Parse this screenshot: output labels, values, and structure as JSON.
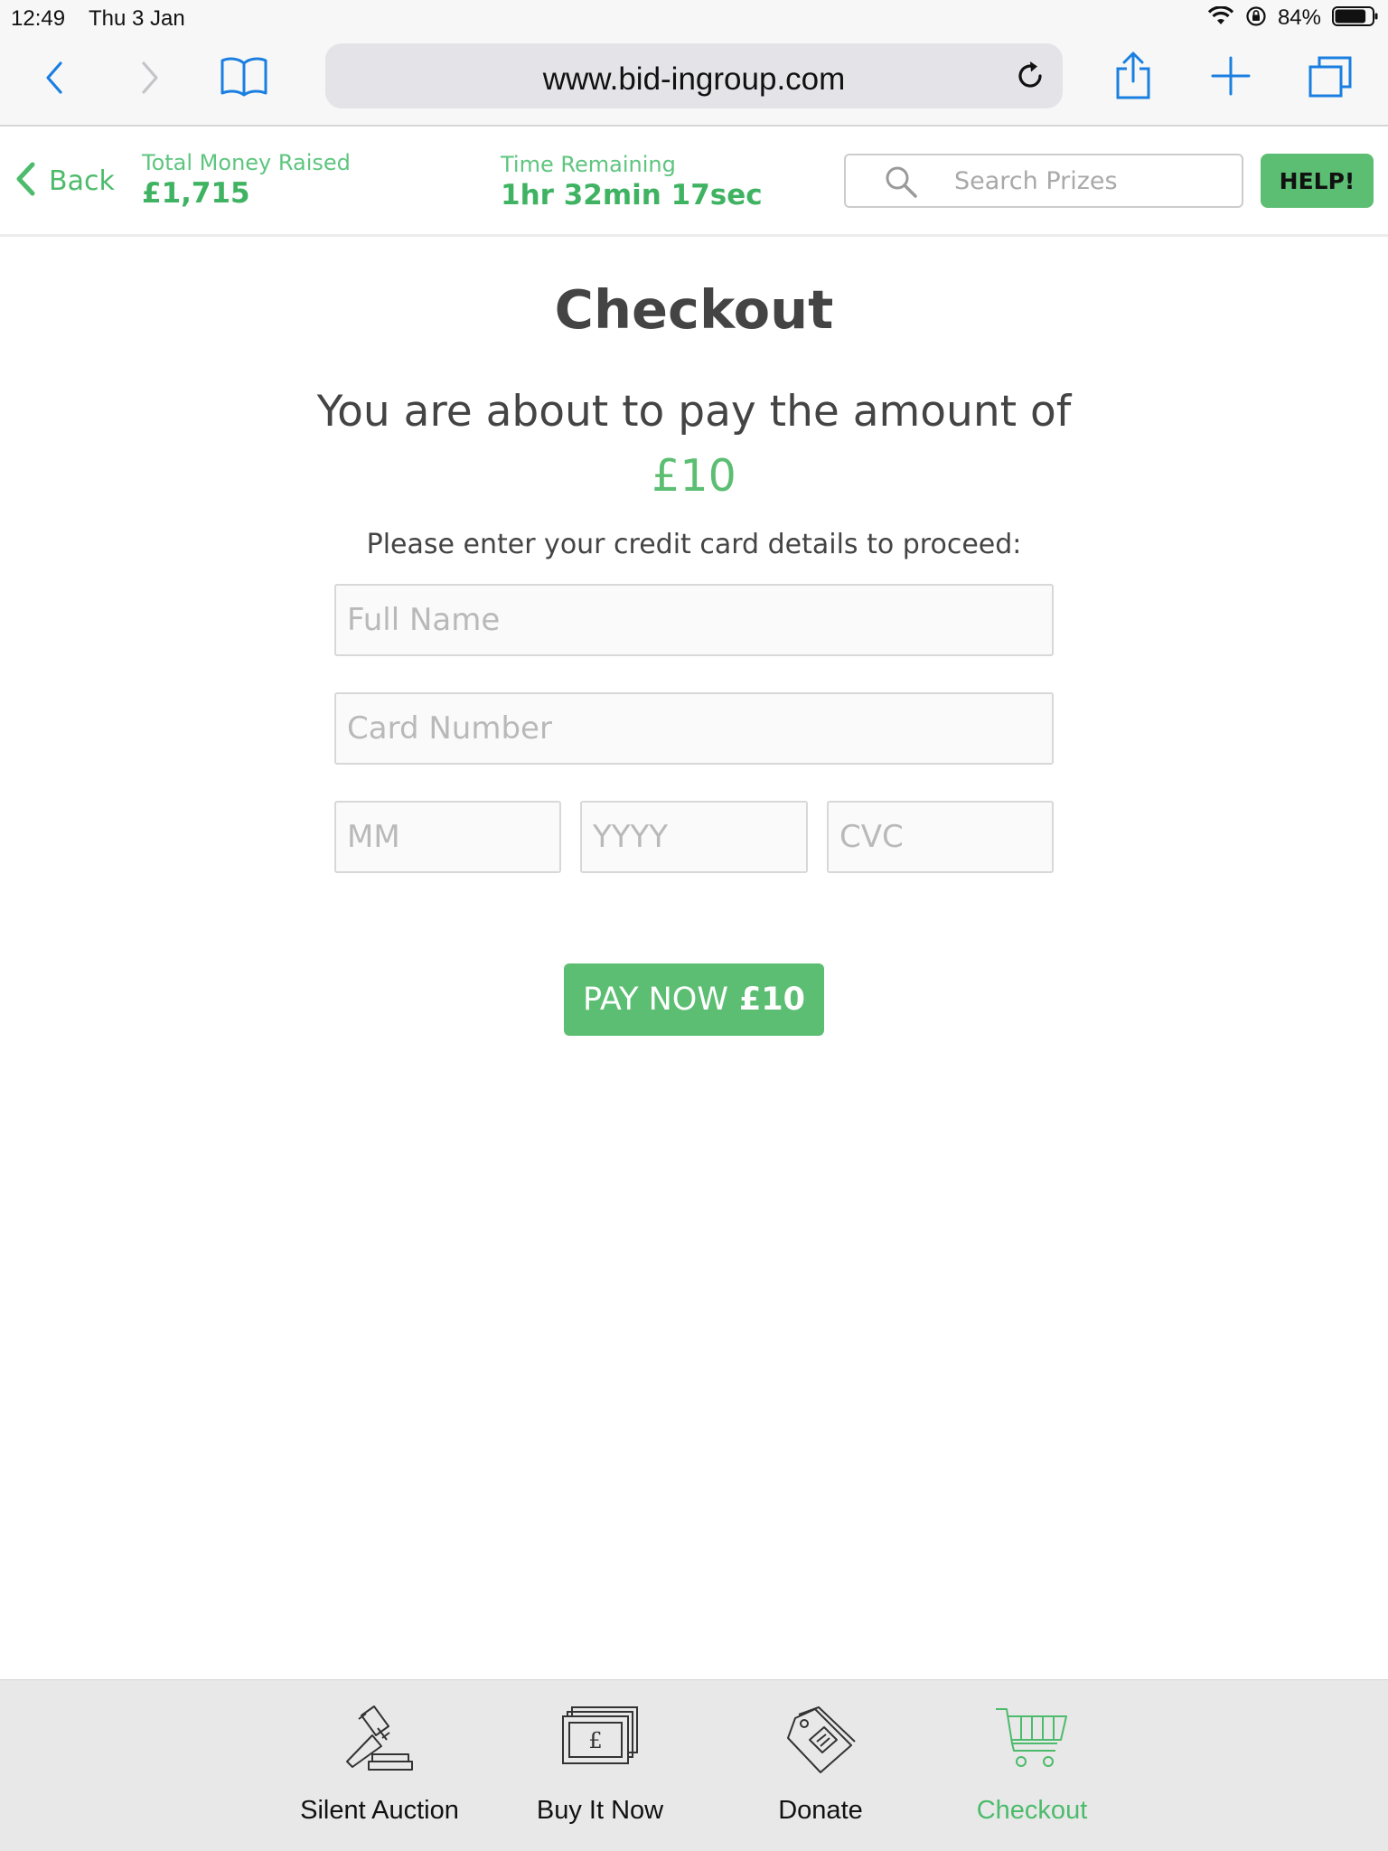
{
  "status_bar": {
    "time": "12:49",
    "date": "Thu 3 Jan",
    "battery_pct": "84%",
    "battery_level": 0.84
  },
  "browser": {
    "url": "www.bid-ingroup.com"
  },
  "header": {
    "back_label": "Back",
    "total_label": "Total Money Raised",
    "total_value": "£1,715",
    "time_label": "Time Remaining",
    "time_value": "1hr 32min 17sec",
    "search_placeholder": "Search Prizes",
    "help_label": "HELP!"
  },
  "checkout": {
    "title": "Checkout",
    "lead_text": "You are about to pay the amount of",
    "amount": "£10",
    "instructions": "Please enter your credit card details to proceed:",
    "fields": {
      "full_name_placeholder": "Full Name",
      "card_number_placeholder": "Card Number",
      "month_placeholder": "MM",
      "year_placeholder": "YYYY",
      "cvc_placeholder": "CVC"
    },
    "pay_label": "PAY NOW",
    "pay_amount": "£10"
  },
  "tabs": [
    {
      "label": "Silent Auction",
      "icon": "gavel-icon",
      "active": false
    },
    {
      "label": "Buy It Now",
      "icon": "banknote-icon",
      "active": false
    },
    {
      "label": "Donate",
      "icon": "price-tag-icon",
      "active": false
    },
    {
      "label": "Checkout",
      "icon": "cart-icon",
      "active": true
    }
  ],
  "colors": {
    "accent_green": "#5cbe72",
    "ios_blue": "#1a7fe0",
    "text_dark": "#444444"
  }
}
